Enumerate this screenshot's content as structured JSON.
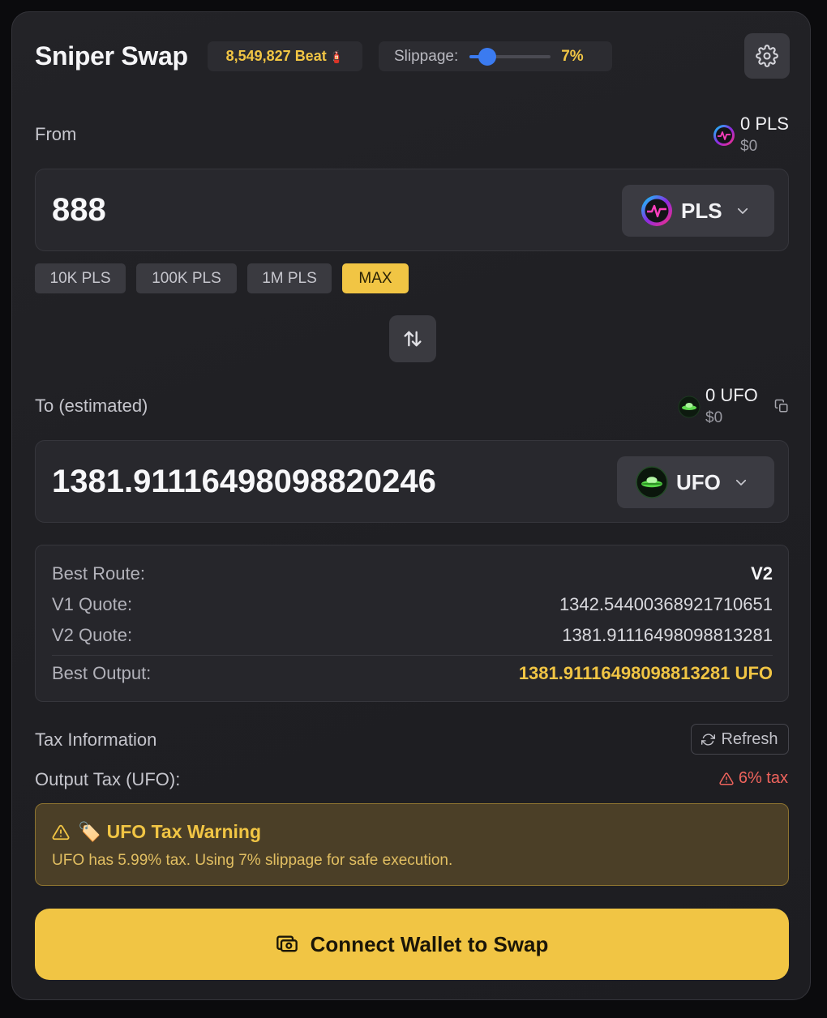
{
  "header": {
    "title": "Sniper Swap",
    "beat_balance": "8,549,827 Beat",
    "beat_symbol": "🧯",
    "slippage_label": "Slippage:",
    "slippage_value": "7%",
    "slippage_level_percent": 7,
    "settings_icon": "gear-icon"
  },
  "from": {
    "label": "From",
    "balance_amount": "0 PLS",
    "balance_usd": "$0",
    "amount": "888",
    "token_symbol": "PLS",
    "token_icon": "pulsechain-logo-icon",
    "quick_buttons": [
      "10K PLS",
      "100K PLS",
      "1M PLS",
      "MAX"
    ]
  },
  "to": {
    "label": "To (estimated)",
    "balance_amount": "0 UFO",
    "balance_usd": "$0",
    "amount": "1381.91116498098820246",
    "token_symbol": "UFO",
    "token_icon": "ufo-logo-icon"
  },
  "route": {
    "rows": [
      {
        "key": "Best Route:",
        "value": "V2"
      },
      {
        "key": "V1 Quote:",
        "value": "1342.54400368921710651"
      },
      {
        "key": "V2 Quote:",
        "value": "1381.91116498098813281"
      }
    ],
    "best_output_label": "Best Output:",
    "best_output_value": "1381.91116498098813281 UFO"
  },
  "tax": {
    "section_title": "Tax Information",
    "refresh_label": "Refresh",
    "output_tax_label": "Output Tax (UFO):",
    "output_tax_value": "6% tax",
    "warning_title": "UFO Tax Warning",
    "warning_emoji": "🏷️",
    "warning_text": "UFO has 5.99% tax. Using 7% slippage for safe execution."
  },
  "cta": {
    "connect_label": "Connect Wallet to Swap"
  },
  "colors": {
    "accent": "#f1c544",
    "slider": "#3b7bf0",
    "danger": "#f0645d",
    "background": "#0b0b0d",
    "card": "#232327"
  }
}
